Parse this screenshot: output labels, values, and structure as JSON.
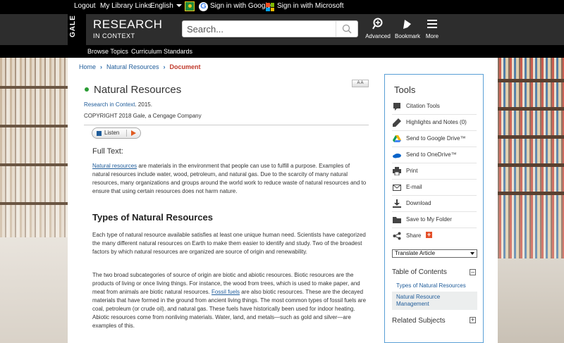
{
  "topbar": {
    "logout": "Logout",
    "library_links": "My Library Links",
    "language": "English",
    "google_signin": "Sign in with Google",
    "microsoft_signin": "Sign in with Microsoft"
  },
  "header": {
    "gale": "GALE",
    "brand_line1": "RESEARCH",
    "brand_line2": "IN CONTEXT",
    "search_placeholder": "Search...",
    "advanced": "Advanced",
    "bookmark": "Bookmark",
    "more": "More"
  },
  "nav": {
    "browse_topics": "Browse Topics",
    "curriculum": "Curriculum Standards"
  },
  "breadcrumb": {
    "home": "Home",
    "natural_resources": "Natural Resources",
    "current": "Document"
  },
  "document": {
    "title": "Natural Resources",
    "font_size_control": "A A",
    "source_link": "Research in Context",
    "source_year": ". 2015.",
    "copyright": "COPYRIGHT 2018 Gale, a Cengage Company",
    "listen": "Listen",
    "full_text_label": "Full Text:",
    "p1_link": "Natural resources",
    "p1_rest": " are materials in the environment that people can use to fulfill a purpose. Examples of natural resources include water, wood, petroleum, and natural gas. Due to the scarcity of many natural resources, many organizations and groups around the world work to reduce waste of natural resources and to ensure that using certain resources does not harm nature.",
    "heading1": "Types of Natural Resources",
    "p2": "Each type of natural resource available satisfies at least one unique human need. Scientists have categorized the many different natural resources on Earth to make them easier to identify and study. Two of the broadest factors by which natural resources are organized are source of origin and renewability.",
    "p3_start": "The two broad subcategories of source of origin are biotic and abiotic resources. Biotic resources are the products of living or once living things. For instance, the wood from trees, which is used to make paper, and meat from animals are biotic natural resources. ",
    "p3_link": "Fossil fuels",
    "p3_rest": " are also biotic resources. These are the decayed materials that have formed in the ground from ancient living things. The most common types of fossil fuels are coal, petroleum (or crude oil), and natural gas. These fuels have historically been used for indoor heating. Abiotic resources come from nonliving materials. Water, land, and metals—such as gold and silver—are examples of this."
  },
  "tools": {
    "title": "Tools",
    "items": [
      {
        "label": "Citation Tools",
        "icon": "citation-icon"
      },
      {
        "label": "Highlights and Notes (0)",
        "icon": "highlight-pen-icon"
      },
      {
        "label": "Send to Google Drive™",
        "icon": "google-drive-icon"
      },
      {
        "label": "Send to OneDrive™",
        "icon": "onedrive-icon"
      },
      {
        "label": "Print",
        "icon": "print-icon"
      },
      {
        "label": "E-mail",
        "icon": "email-icon"
      },
      {
        "label": "Download",
        "icon": "download-icon"
      },
      {
        "label": "Save to My Folder",
        "icon": "folder-icon"
      },
      {
        "label": "Share",
        "icon": "share-icon"
      }
    ],
    "translate": "Translate Article",
    "toc_title": "Table of Contents",
    "toc_items": [
      "Types of Natural Resources",
      "Natural Resource Management"
    ],
    "related_subjects": "Related Subjects",
    "accent_color": "#5aa0d6",
    "link_color": "#1f5c9a"
  }
}
